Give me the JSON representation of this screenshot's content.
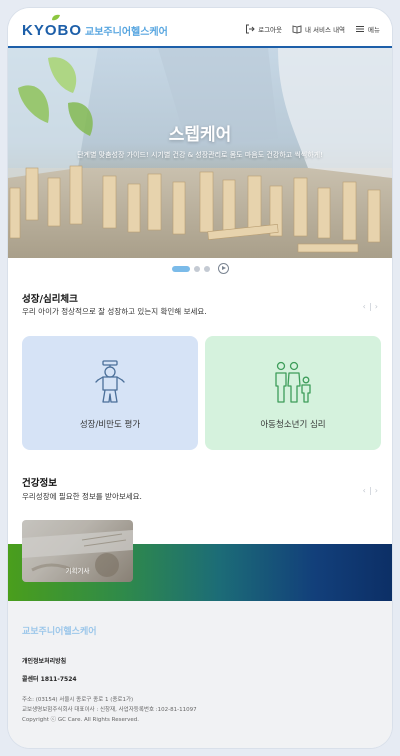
{
  "header": {
    "logo_brand": "KYOBO",
    "logo_sub": "교보주니어헬스케어",
    "nav": {
      "login": "로그아웃",
      "services": "내 서비스 내역",
      "menu": "메뉴"
    }
  },
  "banner": {
    "title": "스텝케어",
    "subtitle": "단계별 맞춤성장 가이드! 시기별 건강 & 성장관리로 몸도 마음도 건강하고 씩씩하게!",
    "slide_count": 3,
    "active_slide": 1
  },
  "growth_section": {
    "title": "성장/심리체크",
    "desc": "우리 아이가 정상적으로 잘 성장하고 있는지 확인해 보세요.",
    "cards": [
      {
        "label": "성장/비만도 평가"
      },
      {
        "label": "아동청소년기 심리"
      }
    ]
  },
  "health_section": {
    "title": "건강정보",
    "desc": "우리성장에 필요한 정보를 받아보세요.",
    "cards": [
      {
        "label": "기획기사"
      }
    ]
  },
  "footer": {
    "brand": "교보주니어헬스케어",
    "privacy": "개인정보처리방침",
    "phone": "콜센터 1811-7524",
    "address": "주소: (03154) 서울시 종로구 종로 1 (종로1가)",
    "company": "교보생명보험주식회사 대표이사 : 신창재, 사업자등록번호 :102-81-11097",
    "copyright": "Copyright ⓒ GC Care. All Rights Reserved."
  },
  "colors": {
    "brand_blue": "#1d5fa9",
    "light_blue": "#58a6e0",
    "card_blue": "#d6e3f6",
    "card_green": "#d5f2dd"
  }
}
